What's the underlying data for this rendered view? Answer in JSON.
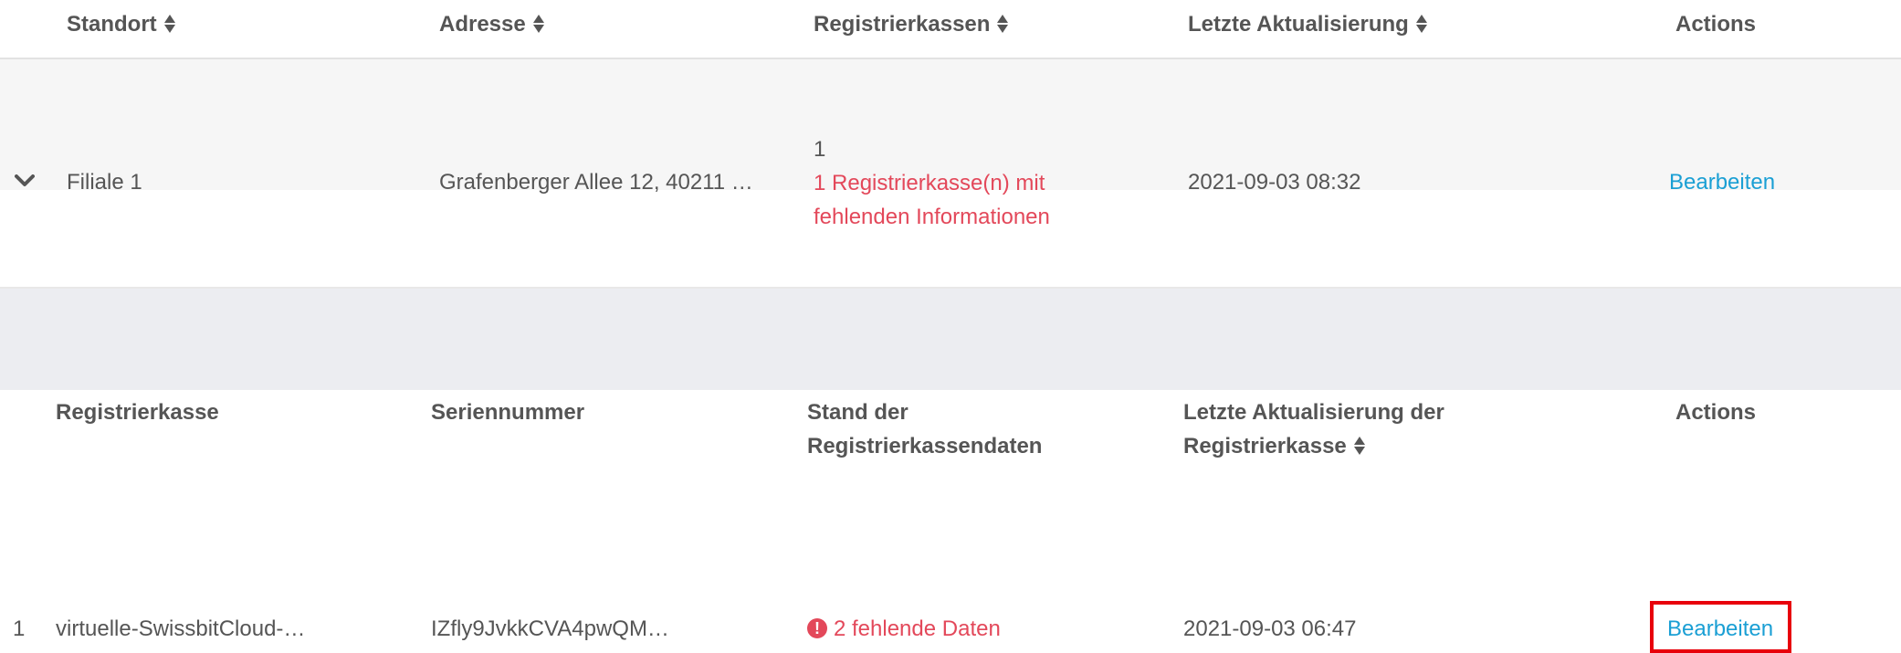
{
  "main_table": {
    "headers": [
      "Standort",
      "Adresse",
      "Registrierkassen",
      "Letzte Aktualisierung",
      "Actions"
    ],
    "row": {
      "location": "Filiale 1",
      "address": "Grafenberger Allee 12, 40211 …",
      "register_count": "1",
      "register_warning": "1 Registrierkasse(n) mit fehlenden Informationen",
      "last_updated": "2021-09-03 08:32",
      "action": "Bearbeiten"
    }
  },
  "sub_table": {
    "headers": [
      "Registrierkasse",
      "Seriennummer",
      "Stand der Registrierkassendaten",
      "Letzte Aktualisierung der Registrierkasse",
      "Actions"
    ],
    "row": {
      "index": "1",
      "register": "virtuelle-SwissbitCloud-…",
      "serial": "IZfly9JvkkCVA4pwQM…",
      "status": "2 fehlende Daten",
      "last_updated": "2021-09-03 06:47",
      "action": "Bearbeiten"
    }
  },
  "colors": {
    "warning": "#e3485a",
    "link": "#1a9fd4",
    "highlight_border": "#e8000b",
    "row_gray": "#f6f6f6",
    "sub_row_gray": "#ecedf1"
  },
  "icons": [
    "sort-icon",
    "chevron-down-icon",
    "exclamation-circle-icon"
  ]
}
